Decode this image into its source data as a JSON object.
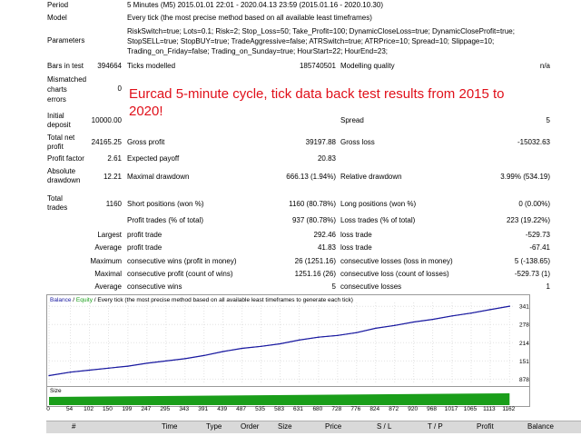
{
  "overlay_text": "Eurcad 5-minute cycle, tick data back test results from 2015 to 2020!",
  "report": {
    "period_label": "Period",
    "period_value": "5 Minutes (M5) 2015.01.01 22:01 - 2020.04.13 23:59 (2015.01.16 - 2020.10.30)",
    "model_label": "Model",
    "model_value": "Every tick (the most precise method based on all available least timeframes)",
    "parameters_label": "Parameters",
    "parameters_lines": [
      "RiskSwitch=true; Lots=0.1; Risk=2; Stop_Loss=50; Take_Profit=100; DynamicCloseLoss=true; DynamicCloseProfit=true;",
      "StopSELL=true; StopBUY=true; TradeAggressive=false; ATRSwitch=true; ATRPrice=10; Spread=10; Slippage=10;",
      "Trading_on_Friday=false; Trading_on_Sunday=true; HourStart=22; HourEnd=23;"
    ],
    "bars_label": "Bars in test",
    "bars_value": "394664",
    "ticks_label": "Ticks modelled",
    "ticks_value": "185740501",
    "quality_label": "Modelling quality",
    "quality_value": "n/a",
    "mismatched_label": [
      "Mismatched",
      "charts",
      "errors"
    ],
    "mismatched_value": "0",
    "initial_label": [
      "Initial",
      "deposit"
    ],
    "initial_value": "10000.00",
    "spread_label": "Spread",
    "spread_value": "5",
    "netprofit_label": [
      "Total net",
      "profit"
    ],
    "netprofit_value": "24165.25",
    "grossprofit_label": "Gross profit",
    "grossprofit_value": "39197.88",
    "grossloss_label": "Gross loss",
    "grossloss_value": "-15032.63",
    "pf_label": "Profit factor",
    "pf_value": "2.61",
    "payoff_label": "Expected payoff",
    "payoff_value": "20.83",
    "absdd_label": [
      "Absolute",
      "drawdown"
    ],
    "absdd_value": "12.21",
    "maxdd_label": "Maximal drawdown",
    "maxdd_value": "666.13 (1.94%)",
    "reldd_label": "Relative drawdown",
    "reldd_value": "3.99% (534.19)",
    "trades_label": [
      "Total",
      "trades"
    ],
    "trades_value": "1160",
    "short_label": "Short positions (won %)",
    "short_value": "1160 (80.78%)",
    "long_label": "Long positions (won %)",
    "long_value": "0 (0.00%)",
    "profittrades_label": "Profit trades (% of total)",
    "profittrades_value": "937 (80.78%)",
    "losstrades_label": "Loss trades (% of total)",
    "losstrades_value": "223 (19.22%)",
    "largest_label": "Largest",
    "largest_profit_label": "profit trade",
    "largest_profit_value": "292.46",
    "largest_loss_label": "loss trade",
    "largest_loss_value": "-529.73",
    "average_label": "Average",
    "average_profit_label": "profit trade",
    "average_profit_value": "41.83",
    "average_loss_label": "loss trade",
    "average_loss_value": "-67.41",
    "maximum_label": "Maximum",
    "maxwins_label": "consecutive wins (profit in money)",
    "maxwins_value": "26 (1251.16)",
    "maxlosses_label": "consecutive losses (loss in money)",
    "maxlosses_value": "5 (-138.65)",
    "maximal_label": "Maximal",
    "maxprofit_label": "consecutive profit (count of wins)",
    "maxprofit_value": "1251.16 (26)",
    "maxloss_label": "consecutive loss (count of losses)",
    "maxloss_value": "-529.73 (1)",
    "average2_label": "Average",
    "avgwins_label": "consecutive wins",
    "avgwins_value": "5",
    "avglosses_label": "consecutive losses",
    "avglosses_value": "1"
  },
  "chart": {
    "legend_balance": "Balance",
    "legend_sep": " / ",
    "legend_equity": "Equity",
    "legend_rest": " / Every tick (the most precise method based on all available least timeframes to generate each tick)",
    "size_label": "Size",
    "line_color": "#1a1aa0",
    "size_color": "#1a9e1a"
  },
  "chart_data": {
    "type": "line",
    "series": [
      {
        "name": "Balance",
        "x": [
          0,
          54,
          102,
          150,
          199,
          247,
          295,
          343,
          391,
          439,
          487,
          535,
          583,
          631,
          680,
          728,
          776,
          824,
          872,
          920,
          968,
          1017,
          1065,
          1113,
          1162
        ],
        "values": [
          10000,
          11200,
          11900,
          12600,
          13300,
          14300,
          15100,
          15900,
          17000,
          18400,
          19500,
          20200,
          21100,
          22400,
          23400,
          24000,
          25000,
          26500,
          27500,
          28700,
          29600,
          30800,
          31800,
          33000,
          34200
        ]
      },
      {
        "name": "Equity",
        "x": [
          0,
          54,
          102,
          150,
          199,
          247,
          295,
          343,
          391,
          439,
          487,
          535,
          583,
          631,
          680,
          728,
          776,
          824,
          872,
          920,
          968,
          1017,
          1065,
          1113,
          1162
        ],
        "values": [
          10000,
          11200,
          11900,
          12600,
          13300,
          14300,
          15100,
          15900,
          17000,
          18400,
          19500,
          20200,
          21100,
          22400,
          23400,
          24000,
          25000,
          26500,
          27500,
          28700,
          29600,
          30800,
          31800,
          33000,
          34200
        ]
      }
    ],
    "size_series": {
      "name": "Size",
      "x": [
        0,
        1162
      ],
      "values": [
        0.1,
        0.1
      ]
    },
    "ylim": [
      7000,
      35500
    ],
    "ytick_labels": [
      "34170",
      "27824",
      "21477",
      "15131",
      "8784"
    ],
    "ytick_values": [
      34170,
      27824,
      21477,
      15131,
      8784
    ],
    "xlim": [
      0,
      1175
    ],
    "xtick_labels": [
      "0",
      "54",
      "102",
      "150",
      "199",
      "247",
      "295",
      "343",
      "391",
      "439",
      "487",
      "535",
      "583",
      "631",
      "680",
      "728",
      "776",
      "824",
      "872",
      "920",
      "968",
      "1017",
      "1065",
      "1113",
      "1162"
    ],
    "xtick_values": [
      0,
      54,
      102,
      150,
      199,
      247,
      295,
      343,
      391,
      439,
      487,
      535,
      583,
      631,
      680,
      728,
      776,
      824,
      872,
      920,
      968,
      1017,
      1065,
      1113,
      1162
    ],
    "grid": true
  },
  "table": {
    "columns": [
      "#",
      "Time",
      "Type",
      "Order",
      "Size",
      "Price",
      "S / L",
      "T / P",
      "Profit",
      "Balance"
    ]
  }
}
